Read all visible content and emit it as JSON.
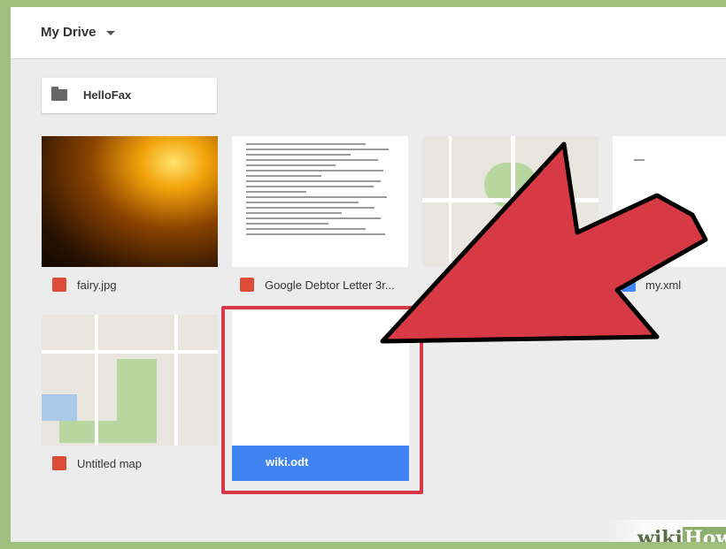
{
  "header": {
    "title": "My Drive"
  },
  "folders": [
    {
      "name": "HelloFax"
    }
  ],
  "files": [
    {
      "name": "fairy.jpg",
      "icon": "image-icon",
      "color": "#dd4b39"
    },
    {
      "name": "Google Debtor Letter 3r...",
      "icon": "pdf-icon",
      "color": "#dd4b39"
    },
    {
      "name": "my.xml",
      "icon": "docs-icon",
      "color": "#4285f4"
    },
    {
      "name": "Untitled map",
      "icon": "map-pin-icon",
      "color": "#dd4b39"
    },
    {
      "name": "wiki.odt",
      "selected": true,
      "highlight_color": "#d63a49",
      "bar_color": "#3f84f0"
    }
  ],
  "watermark": {
    "text": "wiki",
    "text2": "How"
  },
  "arrow": {
    "color": "#d73a44",
    "target": "wiki.odt"
  }
}
